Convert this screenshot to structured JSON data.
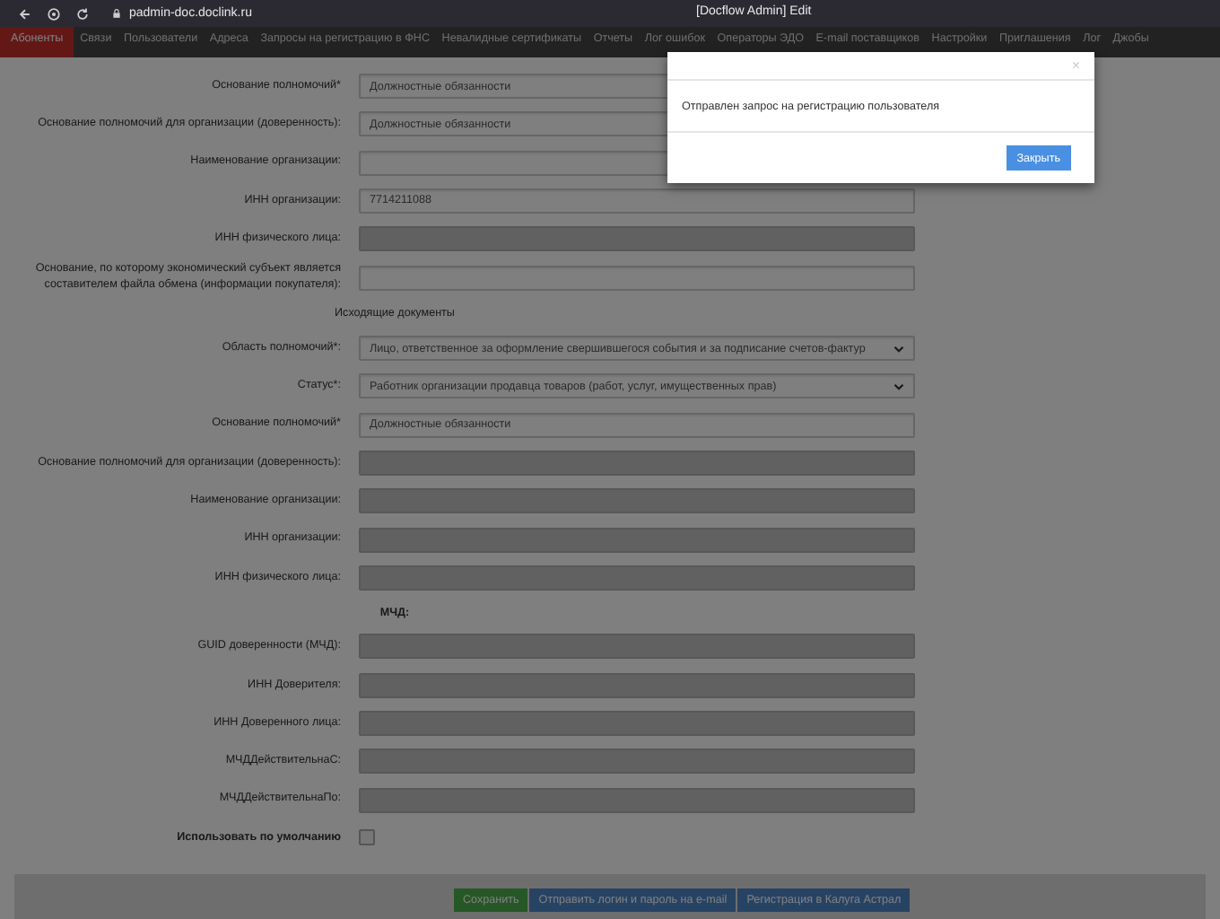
{
  "browser": {
    "url": "padmin-doc.doclink.ru",
    "title": "[Docflow Admin] Edit"
  },
  "nav": [
    {
      "label": "Абоненты",
      "selected": true
    },
    {
      "label": "Связи",
      "selected": false
    },
    {
      "label": "Пользователи",
      "selected": false
    },
    {
      "label": "Адреса",
      "selected": false
    },
    {
      "label": "Запросы на регистрацию в ФНС",
      "selected": false
    },
    {
      "label": "Невалидные сертификаты",
      "selected": false
    },
    {
      "label": "Отчеты",
      "selected": false
    },
    {
      "label": "Лог ошибок",
      "selected": false
    },
    {
      "label": "Операторы ЭДО",
      "selected": false
    },
    {
      "label": "E-mail поставщиков",
      "selected": false
    },
    {
      "label": "Настройки",
      "selected": false
    },
    {
      "label": "Приглашения",
      "selected": false
    },
    {
      "label": "Лог",
      "selected": false
    },
    {
      "label": "Джобы",
      "selected": false
    }
  ],
  "form": [
    {
      "kind": "input",
      "label": "Основание полномочий*",
      "value": "Должностные обязанности",
      "disabled": false
    },
    {
      "kind": "input",
      "label": "Основание полномочий для организации (доверенность):",
      "value": "Должностные обязанности",
      "disabled": false
    },
    {
      "kind": "input",
      "label": "Наименование организации:",
      "disabled": false
    },
    {
      "kind": "input",
      "label": "ИНН организации:",
      "value": "7714211088",
      "disabled": false
    },
    {
      "kind": "input",
      "label": "ИНН физического лица:",
      "disabled": true
    },
    {
      "kind": "input",
      "label": "Основание, по которому экономический субъект является составителем файла обмена (информации покупателя):",
      "disabled": false
    },
    {
      "kind": "heading",
      "label": "Исходящие документы",
      "bold": false
    },
    {
      "kind": "select",
      "label": "Область полномочий*:",
      "value": "Лицо, ответственное за оформление свершившегося события и за подписание счетов-фактур"
    },
    {
      "kind": "select",
      "label": "Статус*:",
      "value": "Работник организации продавца товаров (работ, услуг, имущественных прав)"
    },
    {
      "kind": "input",
      "label": "Основание полномочий*",
      "value": "Должностные обязанности",
      "disabled": false
    },
    {
      "kind": "input",
      "label": "Основание полномочий для организации (доверенность):",
      "disabled": true
    },
    {
      "kind": "input",
      "label": "Наименование организации:",
      "disabled": true
    },
    {
      "kind": "input",
      "label": "ИНН организации:",
      "disabled": true
    },
    {
      "kind": "input",
      "label": "ИНН физического лица:",
      "disabled": true
    },
    {
      "kind": "heading",
      "label": "МЧД:",
      "bold": true
    },
    {
      "kind": "input",
      "label": "GUID доверенности (МЧД):",
      "disabled": true
    },
    {
      "kind": "input",
      "label": "ИНН Доверителя:",
      "disabled": true
    },
    {
      "kind": "input",
      "label": "ИНН Доверенного лица:",
      "disabled": true
    },
    {
      "kind": "input",
      "label": "МЧДДействительнаС:",
      "disabled": true
    },
    {
      "kind": "input",
      "label": "МЧДДействительнаПо:",
      "disabled": true
    },
    {
      "kind": "checkbox",
      "label": "Использовать по умолчанию",
      "checked": false
    }
  ],
  "actions": [
    {
      "label": "Сохранить",
      "kind": "success"
    },
    {
      "label": "Отправить логин и пароль на e-mail",
      "kind": "primary"
    },
    {
      "label": "Регистрация в Калуга Астрал",
      "kind": "primary"
    }
  ],
  "modal": {
    "close": "×",
    "message": "Отправлен запрос на регистрацию пользователя",
    "button": "Закрыть"
  }
}
